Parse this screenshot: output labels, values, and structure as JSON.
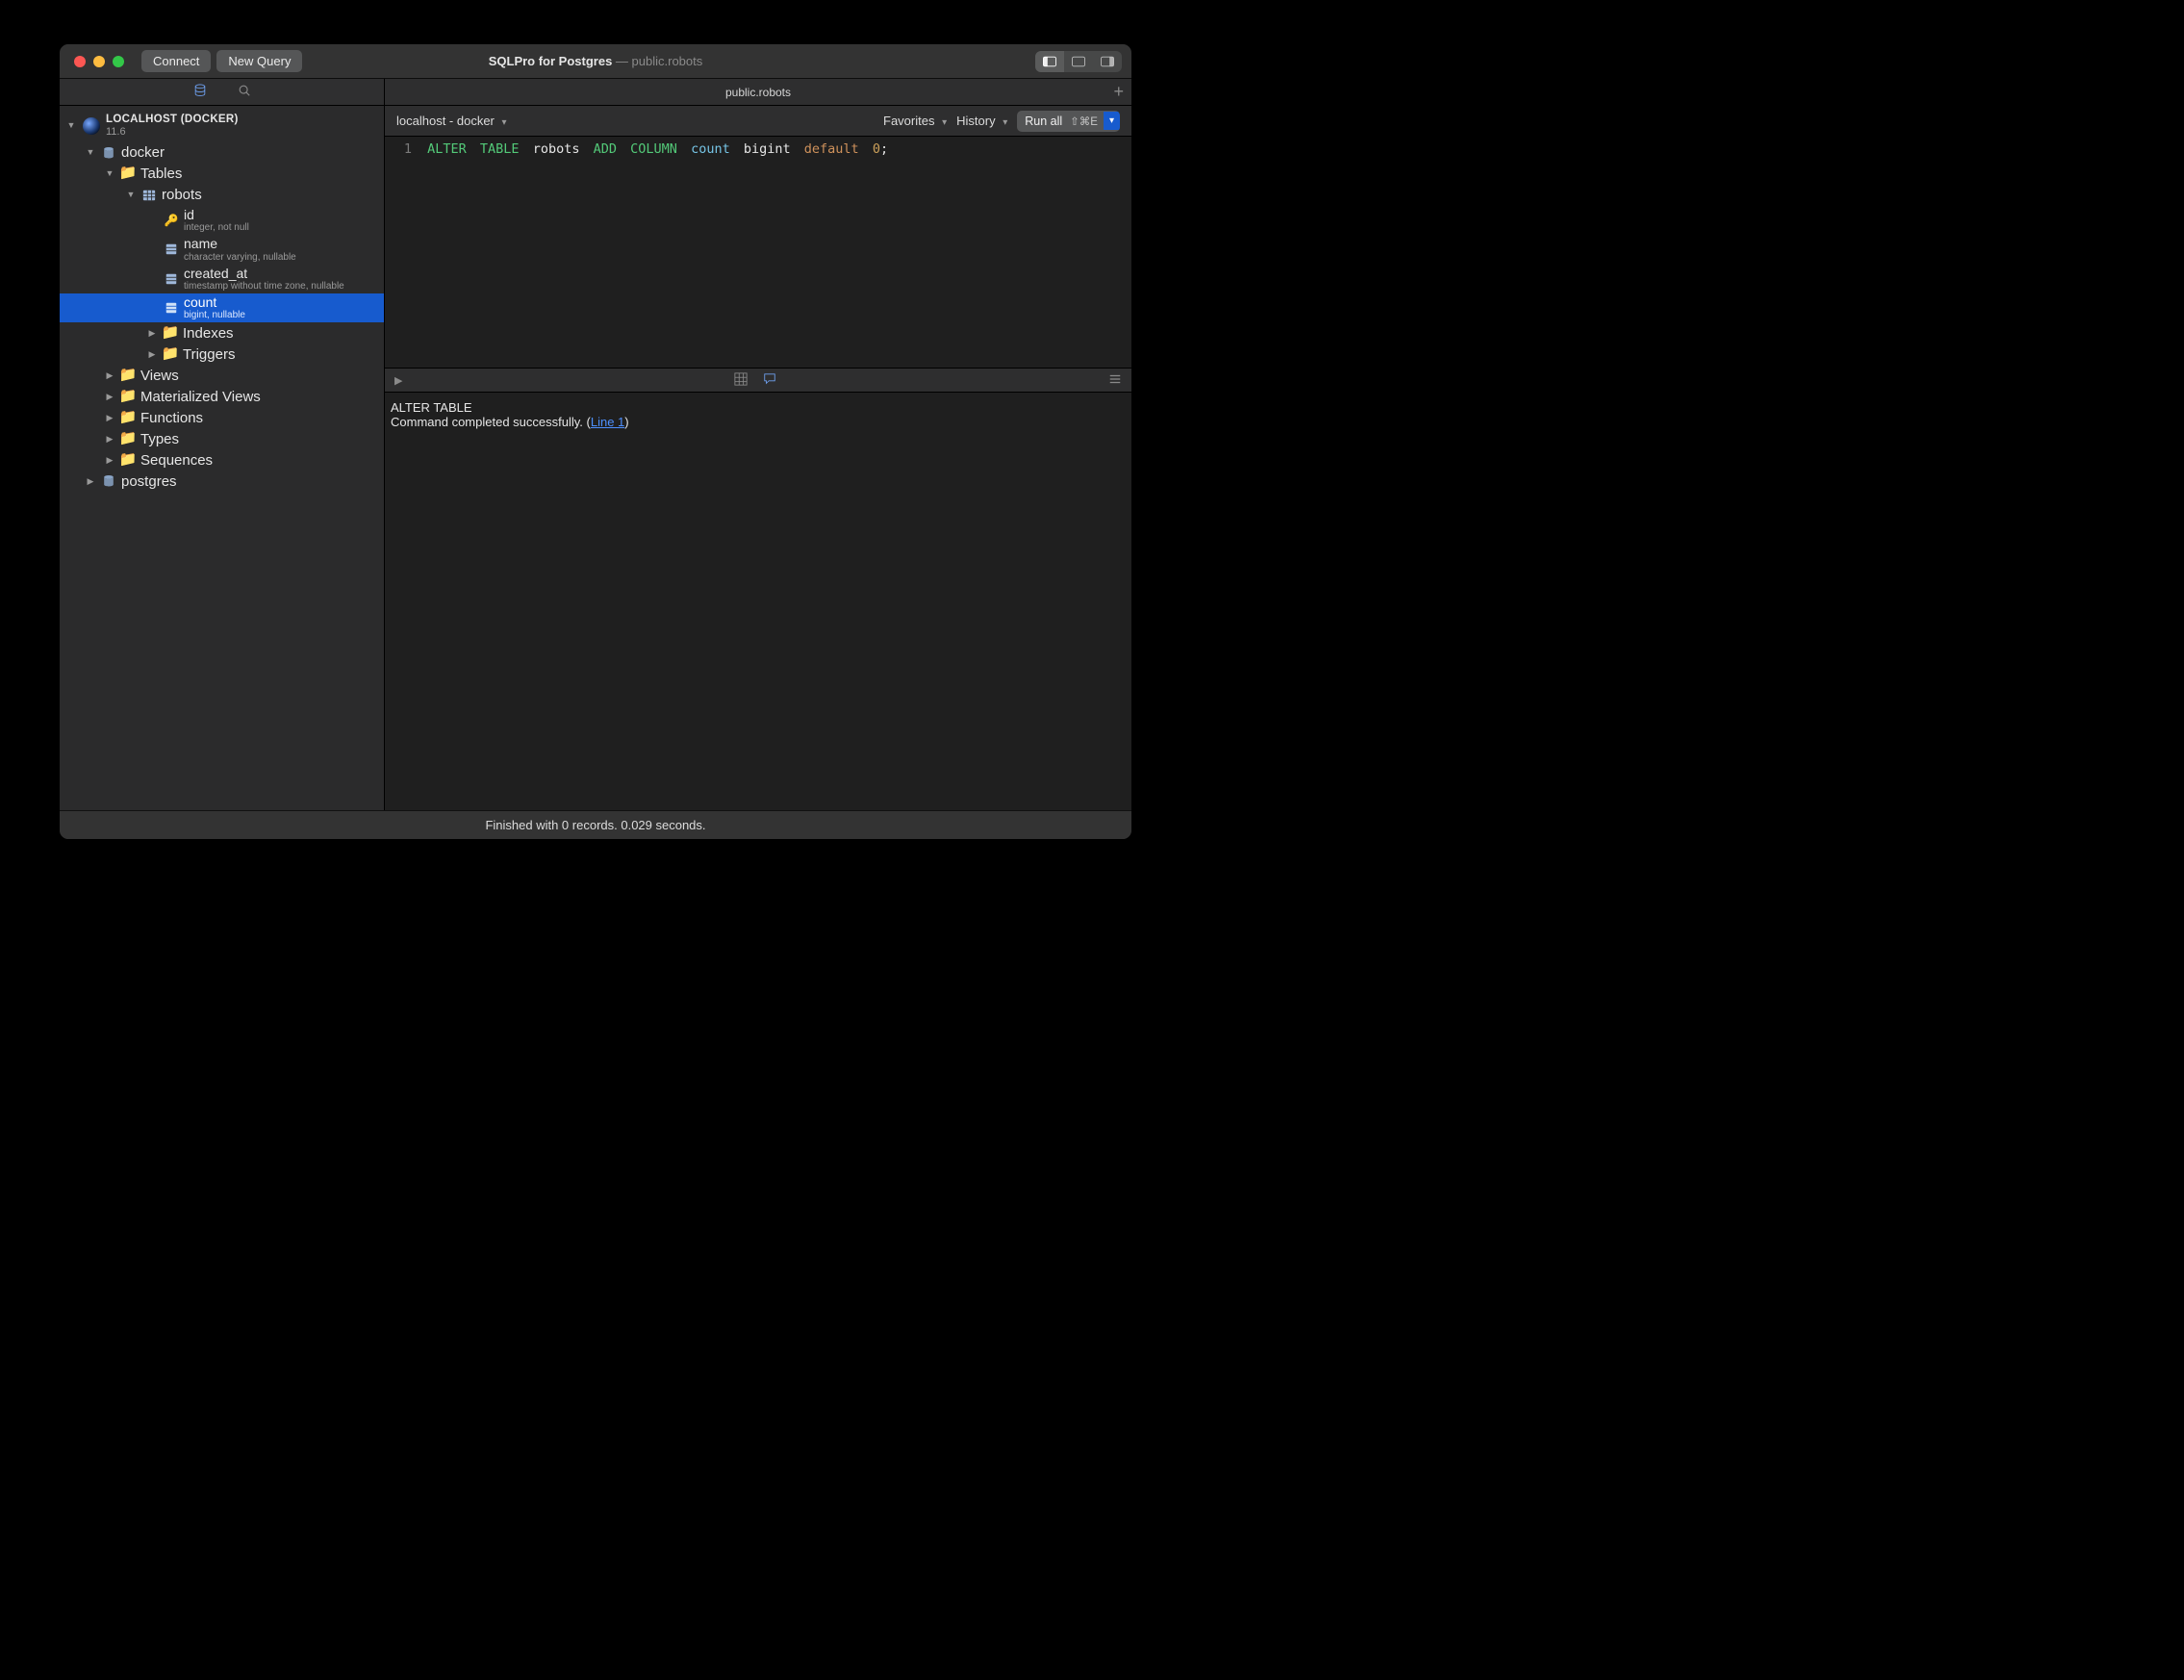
{
  "colors": {
    "accent": "#175bce"
  },
  "titlebar": {
    "connect_label": "Connect",
    "new_query_label": "New Query",
    "app_title": "SQLPro for Postgres",
    "doc_title": "public.robots"
  },
  "sidebar": {
    "connection": {
      "name": "LOCALHOST (DOCKER)",
      "version": "11.6"
    },
    "database": "docker",
    "tables_label": "Tables",
    "table": "robots",
    "columns": [
      {
        "name": "id",
        "detail": "integer, not null",
        "icon": "key"
      },
      {
        "name": "name",
        "detail": "character varying, nullable",
        "icon": "col"
      },
      {
        "name": "created_at",
        "detail": "timestamp without time zone, nullable",
        "icon": "col"
      },
      {
        "name": "count",
        "detail": "bigint, nullable",
        "icon": "col",
        "selected": true
      }
    ],
    "folders": {
      "indexes": "Indexes",
      "triggers": "Triggers",
      "views": "Views",
      "matviews": "Materialized Views",
      "functions": "Functions",
      "types": "Types",
      "sequences": "Sequences"
    },
    "other_db": "postgres"
  },
  "tabs": {
    "active": "public.robots"
  },
  "querybar": {
    "context": "localhost - docker",
    "favorites": "Favorites",
    "history": "History",
    "run_label": "Run all",
    "run_shortcut": "⇧⌘E"
  },
  "editor": {
    "line_no": "1",
    "tokens": {
      "alter": "ALTER",
      "table": "TABLE",
      "robots": "robots",
      "add": "ADD",
      "column": "COLUMN",
      "count": "count",
      "bigint": "bigint",
      "default": "default",
      "zero": "0",
      "semi": ";"
    }
  },
  "results": {
    "header": "ALTER TABLE",
    "msg_pre": "Command completed successfully. (",
    "link": "Line 1",
    "msg_post": ")"
  },
  "statusbar": {
    "text": "Finished with 0 records. 0.029 seconds."
  }
}
